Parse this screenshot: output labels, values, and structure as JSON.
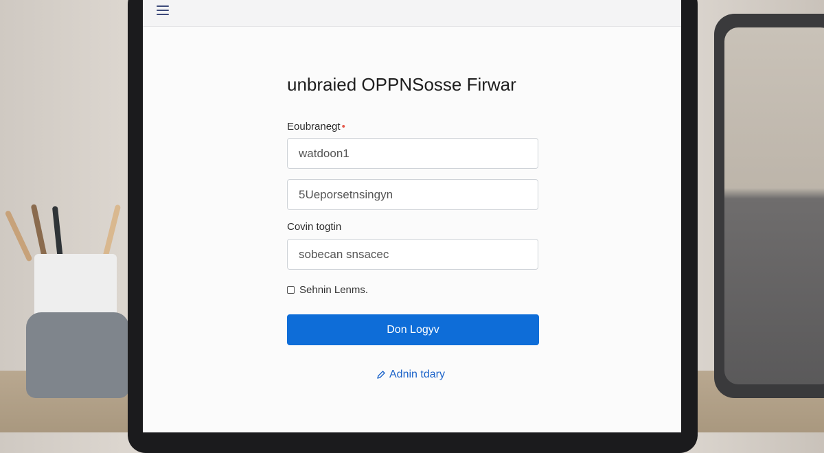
{
  "header": {
    "menu_icon": "hamburger-menu-icon"
  },
  "page": {
    "title": "unbraied OPPNSosse Firwar"
  },
  "form": {
    "label_1": "Eoubranegt",
    "label_1_required_marker": "•",
    "field_1_value": "watdoon1",
    "field_2_value": "5Ueporsetnsingyn",
    "label_2": "Covin togtin",
    "field_3_value": "sobecan snsacec",
    "checkbox_label": "Sehnin Lenms.",
    "checkbox_checked": false,
    "submit_label": "Don Logyv"
  },
  "footer": {
    "link_label": "Adnin tdary",
    "link_icon": "pencil-icon"
  },
  "colors": {
    "primary": "#0e6dd8",
    "link": "#1a62c9",
    "required": "#e4584a"
  }
}
